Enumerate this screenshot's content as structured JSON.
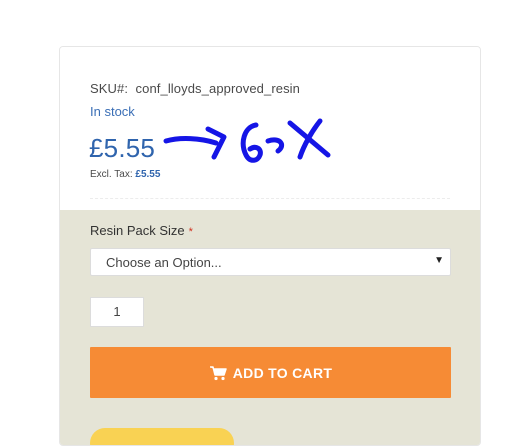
{
  "product": {
    "sku_label": "SKU#:",
    "sku_value": "conf_lloyds_approved_resin",
    "stock_status": "In stock",
    "price": "£5.55",
    "excl_tax_label": "Excl. Tax:",
    "excl_tax_value": "£5.55"
  },
  "options": {
    "label": "Resin Pack Size",
    "required_marker": "*",
    "select_value": "Choose an Option...",
    "arrow": "▼"
  },
  "quantity": {
    "value": "1"
  },
  "cart": {
    "label": "ADD TO CART",
    "icon": "shopping-cart-icon"
  },
  "colors": {
    "price": "#2f64ad",
    "stock": "#3b6fb6",
    "cart_button": "#f68b35",
    "options_panel": "#e5e4d6",
    "annotation": "#1515e6",
    "secondary_button": "#f9d253"
  }
}
